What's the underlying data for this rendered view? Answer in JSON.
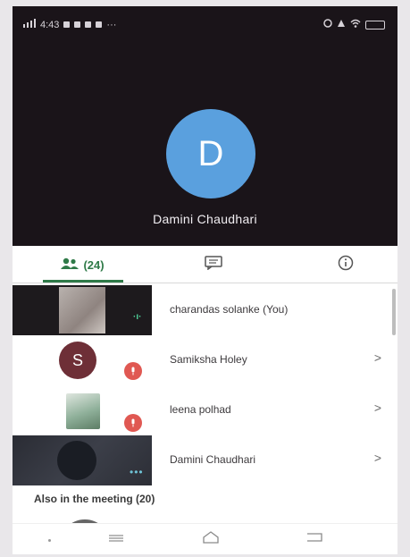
{
  "status_bar": {
    "time": "4:43",
    "left_icons": [
      "signal-icon",
      "notification-icon",
      "notification-icon",
      "notification-icon",
      "notification-icon",
      "more-icon"
    ],
    "right_icons": [
      "alarm-icon",
      "network-icon",
      "wifi-icon",
      "battery-icon"
    ]
  },
  "speaker": {
    "avatar_letter": "D",
    "name": "Damini Chaudhari",
    "avatar_color": "#5aa0de"
  },
  "tabs": {
    "people_count": "(24)",
    "active_color": "#2f7a48",
    "icons": [
      "people-icon",
      "chat-icon",
      "info-icon"
    ]
  },
  "participants": [
    {
      "name": "charandas solanke (You)",
      "type": "video",
      "speaking": true
    },
    {
      "name": "Samiksha Holey",
      "type": "avatar",
      "letter": "S",
      "muted": true,
      "chevron": ">"
    },
    {
      "name": "leena polhad",
      "type": "photo",
      "muted": true,
      "chevron": ">"
    },
    {
      "name": "Damini Chaudhari",
      "type": "dark-video",
      "speaking": true,
      "chevron": ">"
    }
  ],
  "section": {
    "also_in_meeting": "Also in the meeting (20)"
  },
  "colors": {
    "muted_badge": "#e05852",
    "speaker_bg": "#1a1419",
    "panel_bg": "#ffffff"
  }
}
